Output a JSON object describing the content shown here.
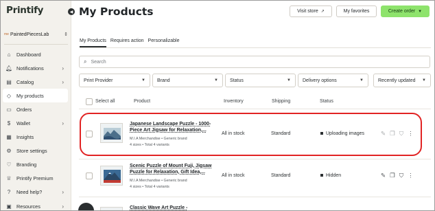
{
  "app": {
    "logo": "Printify"
  },
  "store": {
    "prefix": "me",
    "name": "PaintedPiecesLab"
  },
  "sidebar": {
    "items": [
      {
        "label": "Dashboard",
        "icon": "home-icon",
        "glyph": "⌂",
        "chevron": false,
        "active": false
      },
      {
        "label": "Notifications",
        "icon": "bell-icon",
        "glyph": "🔔︎",
        "chevron": true,
        "active": false
      },
      {
        "label": "Catalog",
        "icon": "book-icon",
        "glyph": "▤",
        "chevron": true,
        "active": false
      },
      {
        "label": "My products",
        "icon": "tag-icon",
        "glyph": "◇",
        "chevron": false,
        "active": true
      },
      {
        "label": "Orders",
        "icon": "box-icon",
        "glyph": "▭",
        "chevron": false,
        "active": false
      },
      {
        "label": "Wallet",
        "icon": "dollar-icon",
        "glyph": "$",
        "chevron": true,
        "active": false
      },
      {
        "label": "Insights",
        "icon": "chart-icon",
        "glyph": "▦",
        "chevron": false,
        "active": false
      },
      {
        "label": "Store settings",
        "icon": "gear-icon",
        "glyph": "⚙",
        "chevron": false,
        "active": false
      },
      {
        "label": "Branding",
        "icon": "heart-icon",
        "glyph": "♡",
        "chevron": false,
        "active": false
      },
      {
        "label": "Printify Premium",
        "icon": "crown-icon",
        "glyph": "♕",
        "chevron": false,
        "active": false
      },
      {
        "label": "Need help?",
        "icon": "help-icon",
        "glyph": "?",
        "chevron": true,
        "active": false
      },
      {
        "label": "Resources",
        "icon": "folder-icon",
        "glyph": "▣",
        "chevron": true,
        "active": false
      }
    ]
  },
  "header": {
    "title": "My Products",
    "visit_store": "Visit store",
    "my_favorites": "My favorites",
    "create_order": "Create order"
  },
  "tabs": [
    "My Products",
    "Requires action",
    "Personalizable"
  ],
  "search": {
    "placeholder": "Search"
  },
  "filters": [
    "Print Provider",
    "Brand",
    "Status",
    "Delivery options",
    "Recently updated"
  ],
  "table": {
    "select_all": "Select all",
    "columns": {
      "product": "Product",
      "inventory": "Inventory",
      "shipping": "Shipping",
      "status": "Status"
    },
    "rows": [
      {
        "title_line1": "Japanese Landscape Puzzle - 1000-",
        "title_line2": "Piece Art Jigsaw for Relaxation,...",
        "brand": "M.I.A Merchandise • Generic brand",
        "variants": "4 sizes • Total 4 variants",
        "inventory": "All in stock",
        "shipping": "Standard",
        "status": "Uploading images"
      },
      {
        "title_line1": "Scenic Puzzle of Mount Fuji, Jigsaw",
        "title_line2": "Puzzle for Relaxation, Gift Idea,...",
        "brand": "M.I.A Merchandise • Generic brand",
        "variants": "4 sizes • Total 4 variants",
        "inventory": "All in stock",
        "shipping": "Standard",
        "status": "Hidden"
      },
      {
        "title_line1": "Classic Wave Art Puzzle -",
        "title_line2": "",
        "brand": "",
        "variants": "",
        "inventory": "",
        "shipping": "",
        "status": ""
      }
    ]
  }
}
